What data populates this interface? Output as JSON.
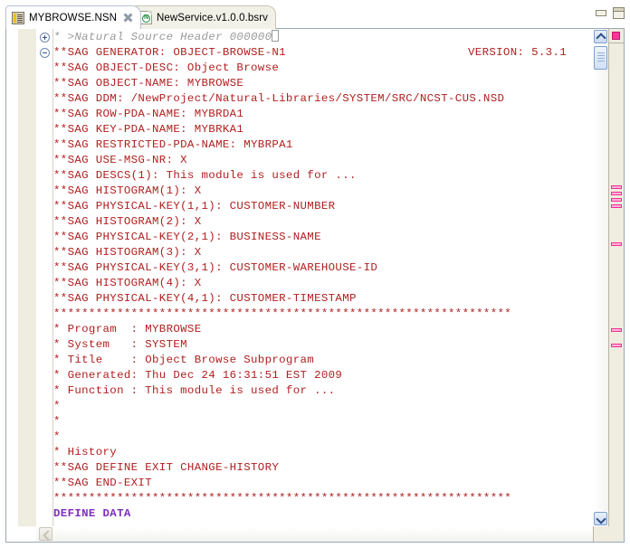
{
  "window": {
    "minimize_label": "Minimize",
    "maximize_label": "Maximize"
  },
  "tabs": [
    {
      "id": "tab-mybrowse-nsn",
      "label": "MYBROWSE.NSN",
      "icon": "natural-source-icon",
      "active": true,
      "closable": true
    },
    {
      "id": "tab-newservice-bsrv",
      "label": "NewService.v1.0.0.bsrv",
      "icon": "business-service-icon",
      "active": false,
      "closable": false
    }
  ],
  "editor": {
    "scrollbar": {
      "vertical_up_label": "Scroll up",
      "vertical_down_label": "Scroll down",
      "horizontal_left_label": "Scroll left"
    },
    "overview_ruler": {
      "top_swatch_color": "#ff3399",
      "mark_color": "#ff2e94",
      "marks_y": [
        173,
        180,
        187,
        194,
        236,
        331,
        348
      ]
    },
    "colors": {
      "comment": "#b02020",
      "header_comment": "#9a9a9a",
      "keyword": "#7f2fbf",
      "background": "#ffffff",
      "gutter": "#efece0"
    },
    "folding": [
      {
        "line": 0,
        "state": "collapsed"
      },
      {
        "line": 1,
        "state": "expanded"
      }
    ],
    "lines": [
      {
        "text": "* >Natural Source Header 000000",
        "style": "header-comment",
        "caret": true
      },
      {
        "text": "**SAG GENERATOR: OBJECT-BROWSE-N1",
        "style": "comment",
        "right_text": "VERSION: 5.3.1"
      },
      {
        "text": "**SAG OBJECT-DESC: Object Browse",
        "style": "comment"
      },
      {
        "text": "**SAG OBJECT-NAME: MYBROWSE",
        "style": "comment"
      },
      {
        "text": "**SAG DDM: /NewProject/Natural-Libraries/SYSTEM/SRC/NCST-CUS.NSD",
        "style": "comment"
      },
      {
        "text": "**SAG ROW-PDA-NAME: MYBRDA1",
        "style": "comment"
      },
      {
        "text": "**SAG KEY-PDA-NAME: MYBRKA1",
        "style": "comment"
      },
      {
        "text": "**SAG RESTRICTED-PDA-NAME: MYBRPA1",
        "style": "comment"
      },
      {
        "text": "**SAG USE-MSG-NR: X",
        "style": "comment"
      },
      {
        "text": "**SAG DESCS(1): This module is used for ...",
        "style": "comment"
      },
      {
        "text": "**SAG HISTOGRAM(1): X",
        "style": "comment"
      },
      {
        "text": "**SAG PHYSICAL-KEY(1,1): CUSTOMER-NUMBER",
        "style": "comment"
      },
      {
        "text": "**SAG HISTOGRAM(2): X",
        "style": "comment"
      },
      {
        "text": "**SAG PHYSICAL-KEY(2,1): BUSINESS-NAME",
        "style": "comment"
      },
      {
        "text": "**SAG HISTOGRAM(3): X",
        "style": "comment"
      },
      {
        "text": "**SAG PHYSICAL-KEY(3,1): CUSTOMER-WAREHOUSE-ID",
        "style": "comment"
      },
      {
        "text": "**SAG HISTOGRAM(4): X",
        "style": "comment"
      },
      {
        "text": "**SAG PHYSICAL-KEY(4,1): CUSTOMER-TIMESTAMP",
        "style": "comment"
      },
      {
        "text": "*****************************************************************",
        "style": "comment"
      },
      {
        "text": "* Program  : MYBROWSE",
        "style": "comment"
      },
      {
        "text": "* System   : SYSTEM",
        "style": "comment"
      },
      {
        "text": "* Title    : Object Browse Subprogram",
        "style": "comment"
      },
      {
        "text": "* Generated: Thu Dec 24 16:31:51 EST 2009",
        "style": "comment"
      },
      {
        "text": "* Function : This module is used for ...",
        "style": "comment"
      },
      {
        "text": "*",
        "style": "comment"
      },
      {
        "text": "*",
        "style": "comment"
      },
      {
        "text": "*",
        "style": "comment"
      },
      {
        "text": "* History",
        "style": "comment"
      },
      {
        "text": "**SAG DEFINE EXIT CHANGE-HISTORY",
        "style": "comment"
      },
      {
        "text": "**SAG END-EXIT",
        "style": "comment"
      },
      {
        "text": "*****************************************************************",
        "style": "comment"
      },
      {
        "text": "DEFINE DATA",
        "style": "keyword-line"
      }
    ]
  }
}
